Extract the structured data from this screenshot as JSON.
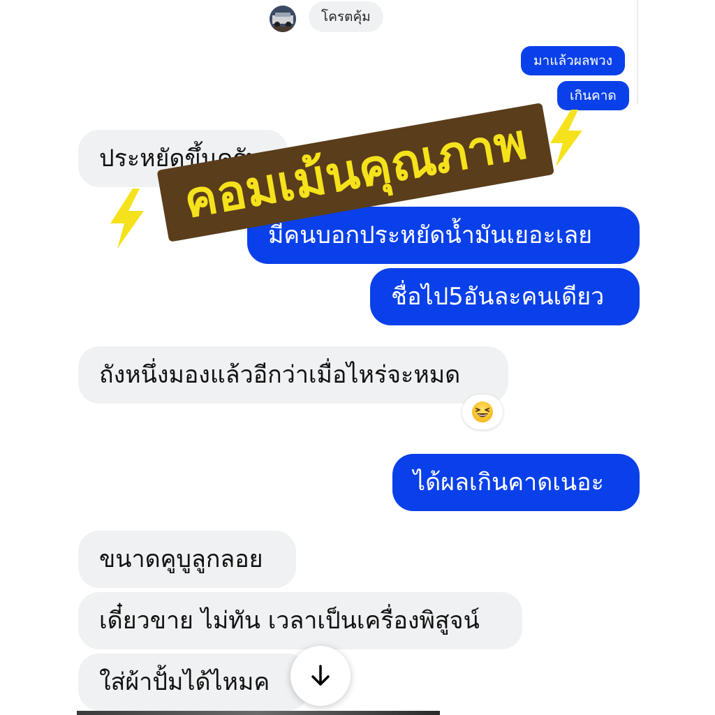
{
  "top_pill": {
    "name": "โครตคุ้ม"
  },
  "outgoing_small": [
    {
      "text": "มาแล้วผลพวง"
    },
    {
      "text": "เกินคาด"
    }
  ],
  "overlay": {
    "text": "คอมเม้นคุณภาพ"
  },
  "messages": {
    "in_1": "ประหยัดขึ้นครับ",
    "out_1": "มีคนบอกประหยัดน้ำมันเยอะเลย",
    "out_2": "ชื่อไป5อันละคนเดียว",
    "in_2": "ถังหนึ่งมองแล้วอีกว่าเมื่อไหร่จะหมด",
    "out_3": "ได้ผลเกินคาดเนอะ",
    "in_3": "ขนาดคูบูลูกลอย",
    "in_4": "เดี๋ยวขาย ไม่ทัน เวลาเป็นเครื่องพิสูจน์",
    "in_5": "ใส่ผ้าปั้มได้ไหมค"
  },
  "reaction": {
    "emoji": "grinning-squinting-face"
  },
  "colors": {
    "outgoing_bubble": "#0a40ea",
    "incoming_bubble": "#f0f1f3",
    "badge_background": "#5a3d1a",
    "badge_text": "#f5e21c",
    "bolt": "#f5e21c"
  },
  "icons": {
    "scroll_down": "arrow-down-icon",
    "lightning": "lightning-bolt-icon"
  }
}
